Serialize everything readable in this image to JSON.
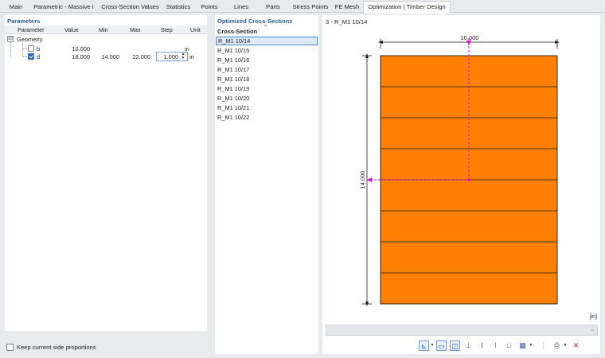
{
  "tabs": [
    {
      "label": "Main",
      "active": false
    },
    {
      "label": "Parametric - Massive I",
      "active": false
    },
    {
      "label": "Cross-Section Values",
      "active": false
    },
    {
      "label": "Statistics",
      "active": false
    },
    {
      "label": "Points",
      "active": false
    },
    {
      "label": "Lines",
      "active": false
    },
    {
      "label": "Parts",
      "active": false
    },
    {
      "label": "Stress Points",
      "active": false
    },
    {
      "label": "FE Mesh",
      "active": false
    },
    {
      "label": "Optimization | Timber Design",
      "active": true
    }
  ],
  "parameters": {
    "title": "Parameters",
    "columns": [
      "Parameter",
      "Value",
      "Min",
      "Max",
      "Step",
      "Unit"
    ],
    "group": {
      "expander": "⊟",
      "label": "Geometry"
    },
    "rows": [
      {
        "name": "b",
        "checked": false,
        "value": "10.000",
        "min": "",
        "max": "",
        "step": "",
        "unit": "in"
      },
      {
        "name": "d",
        "checked": true,
        "value": "18.000",
        "min": "14.000",
        "max": "22.000",
        "step": "1.000",
        "unit": "in"
      }
    ],
    "keep_proportions_label": "Keep current side proportions",
    "keep_proportions_checked": false
  },
  "optimized": {
    "title": "Optimized Cross-Sections",
    "column": "Cross-Section",
    "sort_glyph": "^",
    "items": [
      "R_M1 10/14",
      "R_M1 10/15",
      "R_M1 10/16",
      "R_M1 10/17",
      "R_M1 10/18",
      "R_M1 10/19",
      "R_M1 10/20",
      "R_M1 10/21",
      "R_M1 10/22"
    ],
    "selected_index": 0
  },
  "drawing": {
    "title": "3 - R_M1 10/14",
    "width_label": "10.000",
    "height_label": "14.000",
    "unit_label": "[in]",
    "lamella_count": 8,
    "fill_color": "#ff8000",
    "line_color": "#1a1a1a",
    "axis_color": "#e000e0"
  },
  "toolbar_icons": [
    "display-options-icon",
    "dropdown-icon",
    "frame-icon",
    "section-view-icon",
    "dimension-icon",
    "i-beam-icon",
    "t-beam-icon",
    "lamella-icon",
    "table-icon",
    "dropdown-icon",
    "vertical-dimension-icon",
    "print-icon",
    "dropdown-icon",
    "reset-view-icon"
  ]
}
